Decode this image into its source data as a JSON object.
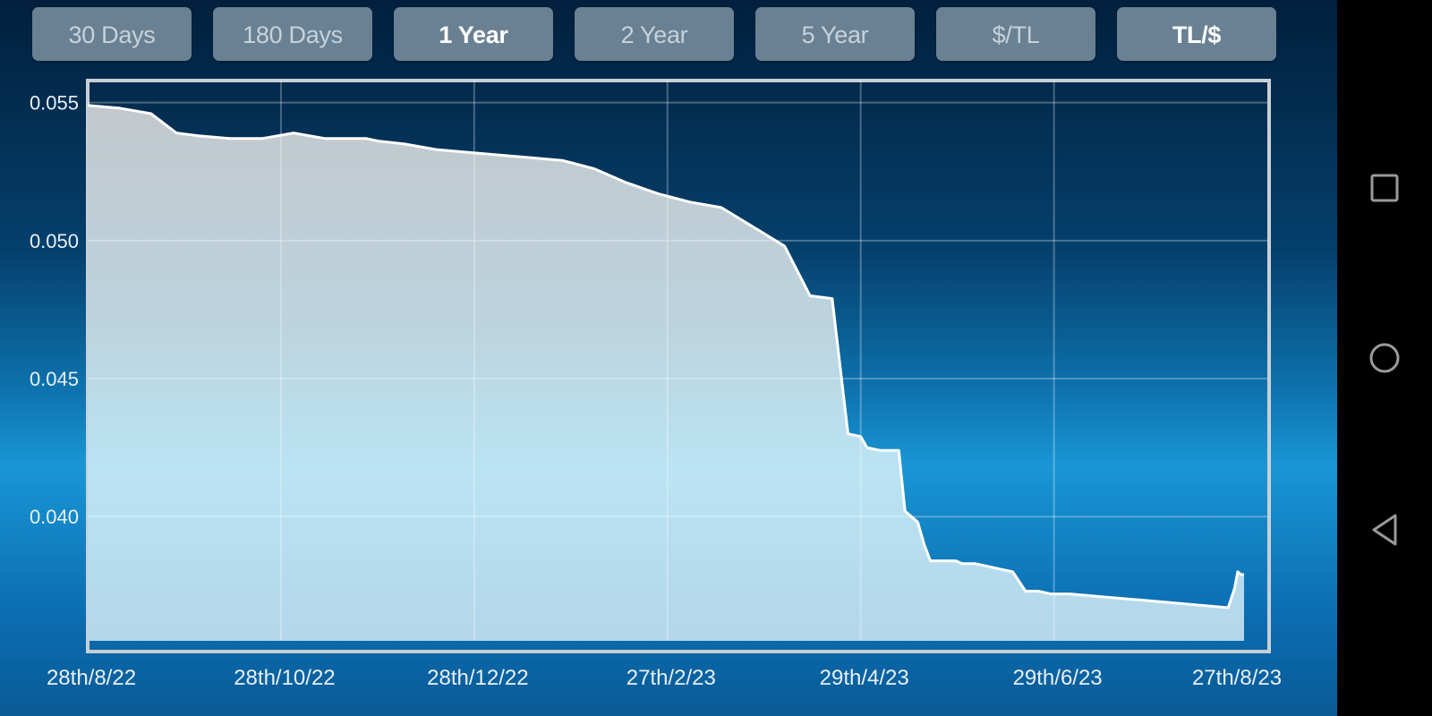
{
  "toolbar": {
    "buttons": [
      {
        "label": "30 Days",
        "active": false
      },
      {
        "label": "180 Days",
        "active": false
      },
      {
        "label": "1 Year",
        "active": true
      },
      {
        "label": "2 Year",
        "active": false
      },
      {
        "label": "5 Year",
        "active": false
      },
      {
        "label": "$/TL",
        "active": false
      },
      {
        "label": "TL/$",
        "active": true
      }
    ]
  },
  "navbar": {
    "icons": [
      "recents-square-icon",
      "home-circle-icon",
      "back-triangle-icon"
    ]
  },
  "colors": {
    "button_bg": "#6a8193",
    "fill_top": "#c0c7cc",
    "fill_bottom": "#b8ddf0",
    "line": "#ffffff"
  },
  "chart_data": {
    "type": "area",
    "title": "",
    "xlabel": "",
    "ylabel": "",
    "series": [
      {
        "name": "TL/$",
        "x_days": [
          0,
          10,
          20,
          28,
          35,
          45,
          55,
          65,
          75,
          80,
          88,
          92,
          100,
          110,
          120,
          130,
          140,
          150,
          160,
          170,
          180,
          190,
          200,
          210,
          220,
          228,
          235,
          240,
          244,
          246,
          250,
          254,
          256,
          258,
          260,
          262,
          264,
          266,
          270,
          274,
          276,
          280,
          284,
          288,
          292,
          296,
          300,
          304,
          310,
          320,
          330,
          340,
          350,
          360,
          362,
          363,
          364,
          365
        ],
        "values": [
          0.0549,
          0.0548,
          0.0546,
          0.0539,
          0.0538,
          0.0537,
          0.0537,
          0.0539,
          0.0537,
          0.0537,
          0.0537,
          0.0536,
          0.0535,
          0.0533,
          0.0532,
          0.0531,
          0.053,
          0.0529,
          0.0526,
          0.0521,
          0.0517,
          0.0514,
          0.0512,
          0.0505,
          0.0498,
          0.048,
          0.0479,
          0.043,
          0.0429,
          0.0425,
          0.0424,
          0.0424,
          0.0424,
          0.0402,
          0.04,
          0.0398,
          0.039,
          0.0384,
          0.0384,
          0.0384,
          0.0383,
          0.0383,
          0.0382,
          0.0381,
          0.038,
          0.0373,
          0.0373,
          0.0372,
          0.0372,
          0.0371,
          0.037,
          0.0369,
          0.0368,
          0.0367,
          0.0374,
          0.038,
          0.0379,
          0.0379
        ]
      }
    ],
    "x_range_days": [
      0,
      365
    ],
    "ylim": [
      0.0355,
      0.0558
    ],
    "y_ticks": [
      {
        "value": 0.055,
        "label": "0.055"
      },
      {
        "value": 0.05,
        "label": "0.050"
      },
      {
        "value": 0.045,
        "label": "0.045"
      },
      {
        "value": 0.04,
        "label": "0.040"
      }
    ],
    "x_ticks": [
      {
        "day": 0,
        "label": "28th/8/22"
      },
      {
        "day": 61,
        "label": "28th/10/22"
      },
      {
        "day": 122,
        "label": "28th/12/22"
      },
      {
        "day": 183,
        "label": "27th/2/23"
      },
      {
        "day": 244,
        "label": "29th/4/23"
      },
      {
        "day": 305,
        "label": "29th/6/23"
      },
      {
        "day": 365,
        "label": "27th/8/23"
      }
    ],
    "grid": true,
    "legend": "none"
  }
}
